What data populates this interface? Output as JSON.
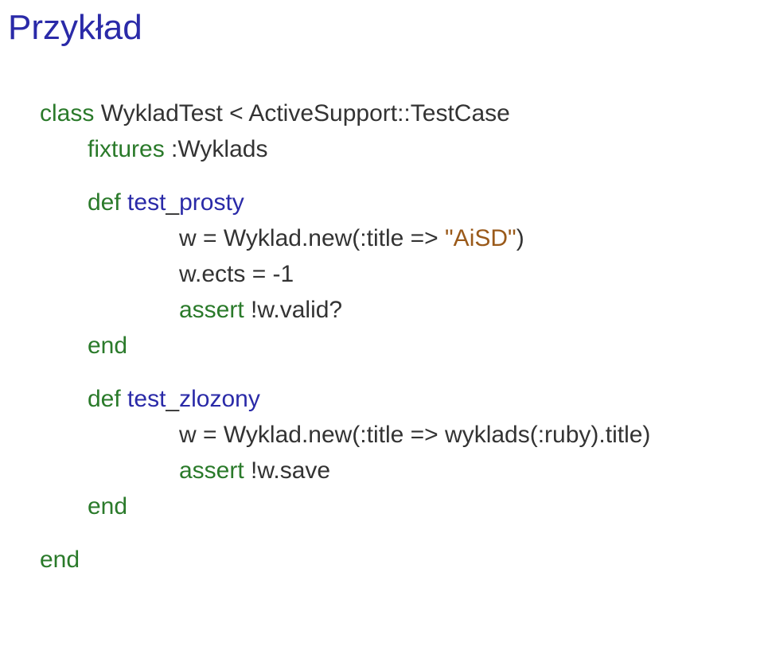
{
  "title": "Przykład",
  "code": {
    "l1_class": "class",
    "l1_rest": " WykladTest < ActiveSupport::TestCase",
    "l2_fixtures": "fixtures",
    "l2_rest": " :Wyklads",
    "l3_def": "def",
    "l3_mid": " test",
    "l3_underscore": "_",
    "l3_prosty": "prosty",
    "l4_pre": "w = Wyklad.new(:title => ",
    "l4_str": "\"AiSD\"",
    "l4_post": ")",
    "l5": "w.ects = -1",
    "l6_assert": "assert",
    "l6_rest": " !w.valid?",
    "l7_end": "end",
    "l8_def": "def",
    "l8_mid": " test",
    "l8_underscore": "_",
    "l8_zlozony": "zlozony",
    "l9": "w = Wyklad.new(:title => wyklads(:ruby).title)",
    "l10_assert": "assert",
    "l10_rest": " !w.save",
    "l11_end": "end",
    "l12_end": "end"
  }
}
